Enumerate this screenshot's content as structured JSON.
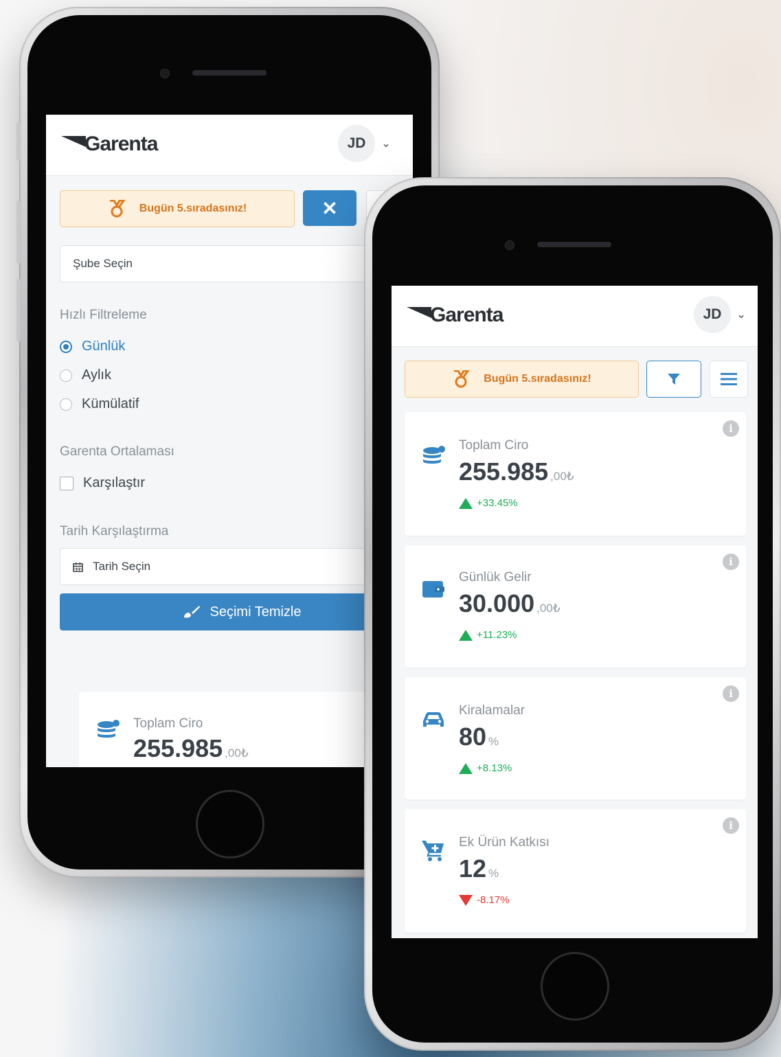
{
  "left_phone": {
    "brand": "Garenta",
    "avatar_initials": "JD",
    "rank_banner": "Bugün 5.sıradasınız!",
    "branch_select": "Şube Seçin",
    "quick_filter": {
      "title": "Hızlı Filtreleme",
      "options": [
        "Günlük",
        "Aylık",
        "Kümülatif"
      ],
      "selected": "Günlük"
    },
    "average": {
      "title": "Garenta Ortalaması",
      "checkbox_label": "Karşılaştır"
    },
    "date_compare": {
      "title": "Tarih Karşılaştırma",
      "placeholder": "Tarih Seçin"
    },
    "clear_button": "Seçimi Temizle",
    "card": {
      "label": "Toplam Ciro",
      "value": "255.985",
      "suffix": ",00₺"
    }
  },
  "right_phone": {
    "brand": "Garenta",
    "avatar_initials": "JD",
    "rank_banner": "Bugün 5.sıradasınız!",
    "cards": [
      {
        "label": "Toplam Ciro",
        "value": "255.985",
        "suffix": ",00₺",
        "change": "+33.45%",
        "trend": "up",
        "icon": "coins-icon"
      },
      {
        "label": "Günlük Gelir",
        "value": "30.000",
        "suffix": ",00₺",
        "change": "+11.23%",
        "trend": "up",
        "icon": "wallet-icon"
      },
      {
        "label": "Kiralamalar",
        "value": "80",
        "suffix": "%",
        "change": "+8.13%",
        "trend": "up",
        "icon": "car-icon"
      },
      {
        "label": "Ek Ürün Katkısı",
        "value": "12",
        "suffix": "%",
        "change": "-8.17%",
        "trend": "down",
        "icon": "cart-plus-icon"
      }
    ]
  },
  "colors": {
    "primary": "#3686c5",
    "rank_text": "#d2761c",
    "rank_bg": "#fdf0dd",
    "up": "#1fae58",
    "down": "#e53935"
  }
}
